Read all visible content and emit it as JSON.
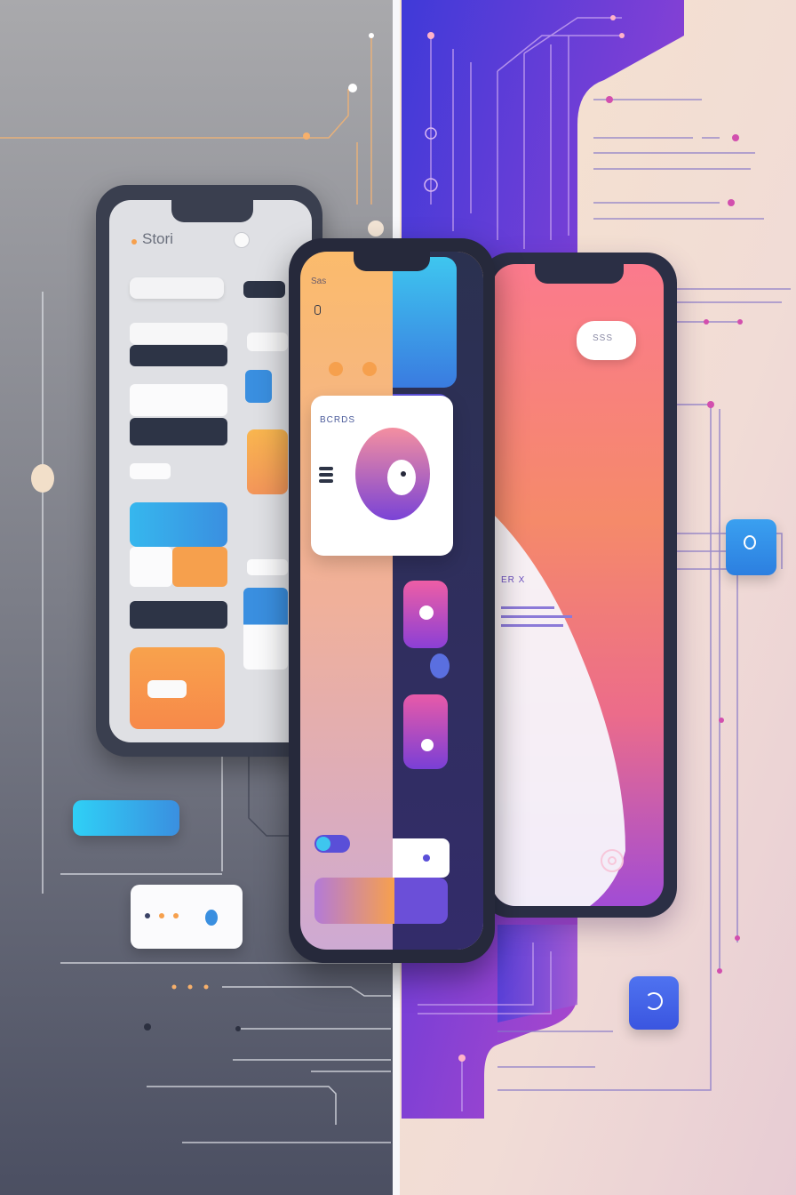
{
  "colors": {
    "left_bg_top": "#a8a8ab",
    "left_bg_bottom": "#4d5163",
    "right_purple": "#5a3fd8",
    "right_magenta": "#b44bc9",
    "right_cream": "#f7e4cc",
    "accent_orange": "#f6a04d",
    "accent_blue": "#3a8fe0",
    "accent_cyan": "#3ec6ef",
    "dark_navy": "#2d3446"
  },
  "left_phone": {
    "header_text": "Stori"
  },
  "center_phone": {
    "header_text": "Sas",
    "card_text": "BCRDS",
    "card_icon": "donut-chart-icon"
  },
  "right_phone": {
    "pill_text": "SSS",
    "banner_text": "ER X"
  },
  "icons": {
    "floating_chat": "chat-bubble-icon",
    "floating_phone": "phone-call-icon",
    "fingerprint": "fingerprint-icon"
  }
}
